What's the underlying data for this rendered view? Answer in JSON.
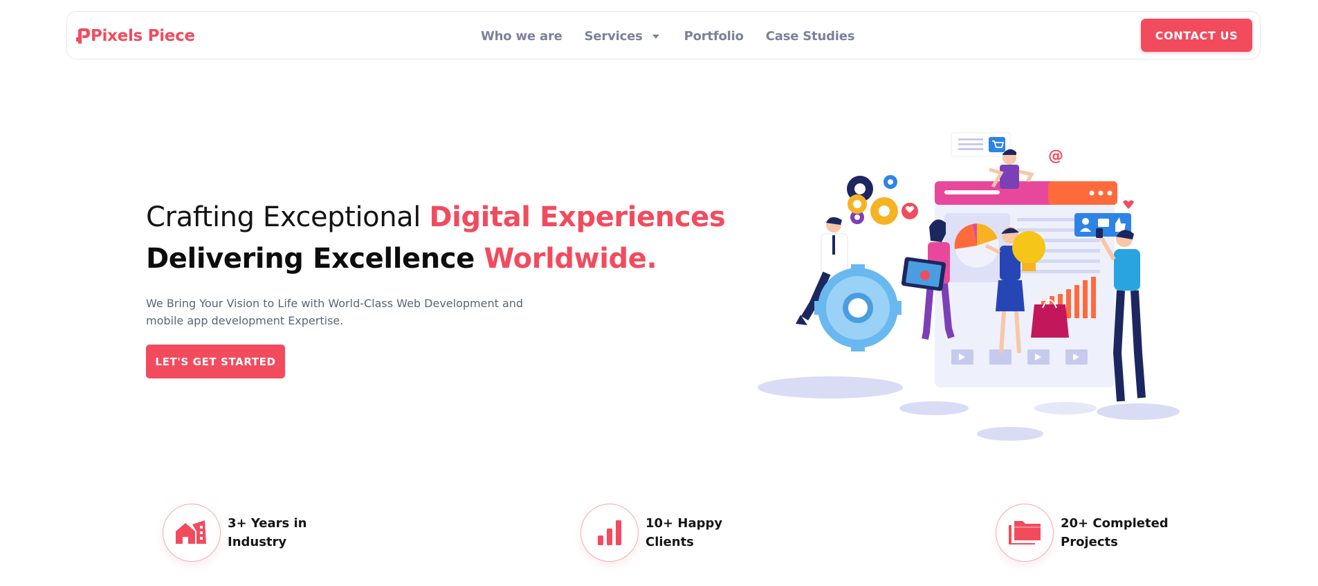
{
  "brand": {
    "name": "Pixels Piece",
    "accent_color": "#f24b5e"
  },
  "nav": {
    "items": [
      {
        "label": "Who we are"
      },
      {
        "label": "Services",
        "has_dropdown": true
      },
      {
        "label": "Portfolio"
      },
      {
        "label": "Case Studies"
      }
    ],
    "contact_label": "CONTACT US"
  },
  "hero": {
    "title_line1_plain": "Crafting Exceptional ",
    "title_line1_accent": "Digital Experiences",
    "title_line2_plain": "Delivering Excellence ",
    "title_line2_accent": "Worldwide.",
    "subtitle": "We Bring Your Vision to Life with World-Class Web Development and mobile app development Expertise.",
    "cta_label": "LET'S GET STARTED",
    "illustration": "team-digital-marketing-illustration"
  },
  "stats": [
    {
      "icon": "building-icon",
      "line1": "3+ Years in",
      "line2": "Industry"
    },
    {
      "icon": "bar-chart-icon",
      "line1": "10+ Happy",
      "line2": "Clients"
    },
    {
      "icon": "folder-icon",
      "line1": "20+ Completed",
      "line2": "Projects"
    }
  ]
}
